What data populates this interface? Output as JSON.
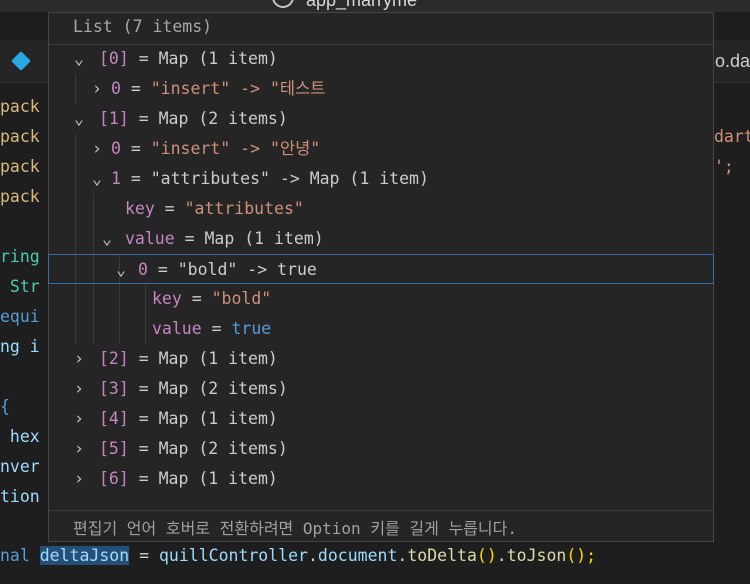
{
  "window": {
    "title": "app_marryme"
  },
  "tabs": {
    "right_fragment": "o.da"
  },
  "editor": {
    "left_lines": [
      "pack",
      "pack",
      "pack",
      "pack",
      "",
      "ring",
      " Str",
      "equi",
      "ng i",
      "",
      "{",
      " hex",
      "nver",
      "tion"
    ],
    "right_lines": [
      "",
      "dart",
      "';"
    ],
    "bottom_line": {
      "prefix": "nal ",
      "var": "deltaJson",
      "eq": " = ",
      "obj": "quillController",
      "dot1": ".",
      "prop": "document",
      "dot2": ".",
      "fn1": "toDelta",
      "paren1": "()",
      "dot3": ".",
      "fn2": "toJson",
      "paren2": "();"
    }
  },
  "hover": {
    "header": "List (7 items)",
    "footer": "편집기 언어 호버로 전환하려면 Option 키를 길게 누릅니다.",
    "rows": [
      {
        "chevron": "⌄",
        "key": "[0]",
        "eq": " = ",
        "val": "Map (1 item)",
        "val_type": "plain"
      },
      {
        "chevron": "›",
        "key": "0",
        "eq": " = ",
        "val": "\"insert\" -> \"테스트",
        "val_type": "string"
      },
      {
        "chevron": "⌄",
        "key": "[1]",
        "eq": " = ",
        "val": "Map (2 items)",
        "val_type": "plain"
      },
      {
        "chevron": "›",
        "key": "0",
        "eq": " = ",
        "val": "\"insert\" -> \"안녕\"",
        "val_type": "string"
      },
      {
        "chevron": "⌄",
        "key": "1",
        "eq": " = ",
        "val": "\"attributes\" -> Map (1 item)",
        "val_type": "plain"
      },
      {
        "chevron": "",
        "key": "key",
        "eq": " = ",
        "val": "\"attributes\"",
        "val_type": "string"
      },
      {
        "chevron": "⌄",
        "key": "value",
        "eq": " = ",
        "val": "Map (1 item)",
        "val_type": "plain"
      },
      {
        "chevron": "⌄",
        "key": "0",
        "eq": " = ",
        "val": "\"bold\" -> true",
        "val_type": "plain"
      },
      {
        "chevron": "",
        "key": "key",
        "eq": " = ",
        "val": "\"bold\"",
        "val_type": "string"
      },
      {
        "chevron": "",
        "key": "value",
        "eq": " = ",
        "val": "true",
        "val_type": "keyword"
      },
      {
        "chevron": "›",
        "key": "[2]",
        "eq": " = ",
        "val": "Map (1 item)",
        "val_type": "plain"
      },
      {
        "chevron": "›",
        "key": "[3]",
        "eq": " = ",
        "val": "Map (2 items)",
        "val_type": "plain"
      },
      {
        "chevron": "›",
        "key": "[4]",
        "eq": " = ",
        "val": "Map (1 item)",
        "val_type": "plain"
      },
      {
        "chevron": "›",
        "key": "[5]",
        "eq": " = ",
        "val": "Map (2 items)",
        "val_type": "plain"
      },
      {
        "chevron": "›",
        "key": "[6]",
        "eq": " = ",
        "val": "Map (1 item)",
        "val_type": "plain"
      }
    ]
  },
  "colors": {
    "key": "#c586c0",
    "string": "#ce9178",
    "keyword": "#569cd6",
    "selection_border": "#3b6ea8"
  }
}
